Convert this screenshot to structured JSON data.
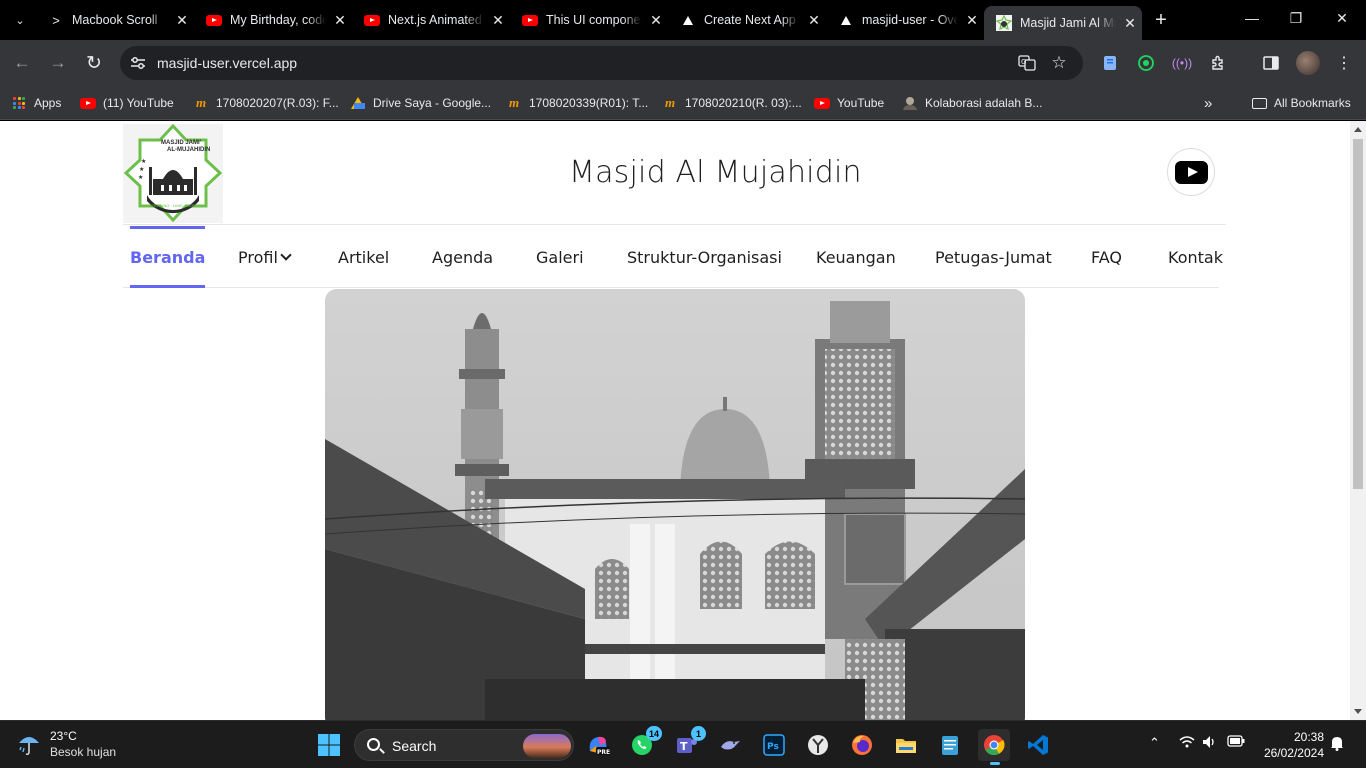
{
  "browser": {
    "tabs": [
      {
        "title": "Macbook Scroll",
        "favicon": "terminal-icon",
        "active": false
      },
      {
        "title": "My Birthday, code",
        "favicon": "youtube-icon",
        "active": false
      },
      {
        "title": "Next.js Animated",
        "favicon": "youtube-icon",
        "active": false
      },
      {
        "title": "This UI component",
        "favicon": "youtube-icon",
        "active": false
      },
      {
        "title": "Create Next App",
        "favicon": "vercel-icon",
        "active": false
      },
      {
        "title": "masjid-user - Ove",
        "favicon": "vercel-icon",
        "active": false
      },
      {
        "title": "Masjid Jami Al Mu",
        "favicon": "masjid-logo-icon",
        "active": true
      }
    ],
    "url": "masjid-user.vercel.app",
    "bookmarks": [
      {
        "label": "Apps",
        "icon": "apps-grid-icon"
      },
      {
        "label": "(11) YouTube",
        "icon": "youtube-icon"
      },
      {
        "label": "1708020207(R.03): F...",
        "icon": "m-icon"
      },
      {
        "label": "Drive Saya - Google...",
        "icon": "google-drive-icon"
      },
      {
        "label": "1708020339(R01): T...",
        "icon": "m-icon"
      },
      {
        "label": "1708020210(R. 03):...",
        "icon": "m-icon"
      },
      {
        "label": "YouTube",
        "icon": "youtube-icon"
      },
      {
        "label": "Kolaborasi adalah B...",
        "icon": "profile-icon"
      }
    ],
    "all_bookmarks": "All Bookmarks"
  },
  "site": {
    "title": "Masjid Al Mujahidin",
    "logo_text": {
      "top": "MASJID JAMI'",
      "middle": "AL-MUJAHIDIN",
      "bottom": "BERUTUNG · LIMO · DEPOK"
    },
    "nav": [
      {
        "label": "Beranda",
        "active": true
      },
      {
        "label": "Profil",
        "dropdown": true
      },
      {
        "label": "Artikel"
      },
      {
        "label": "Agenda"
      },
      {
        "label": "Galeri"
      },
      {
        "label": "Struktur-Organisasi"
      },
      {
        "label": "Keuangan"
      },
      {
        "label": "Petugas-Jumat"
      },
      {
        "label": "FAQ"
      },
      {
        "label": "Kontak"
      }
    ],
    "accent_color": "#6366f1"
  },
  "taskbar": {
    "weather": {
      "temp": "23°C",
      "desc": "Besok hujan"
    },
    "search_label": "Search",
    "badges": {
      "whatsapp": "14",
      "teams": "1"
    },
    "time": "20:38",
    "date": "26/02/2024"
  }
}
